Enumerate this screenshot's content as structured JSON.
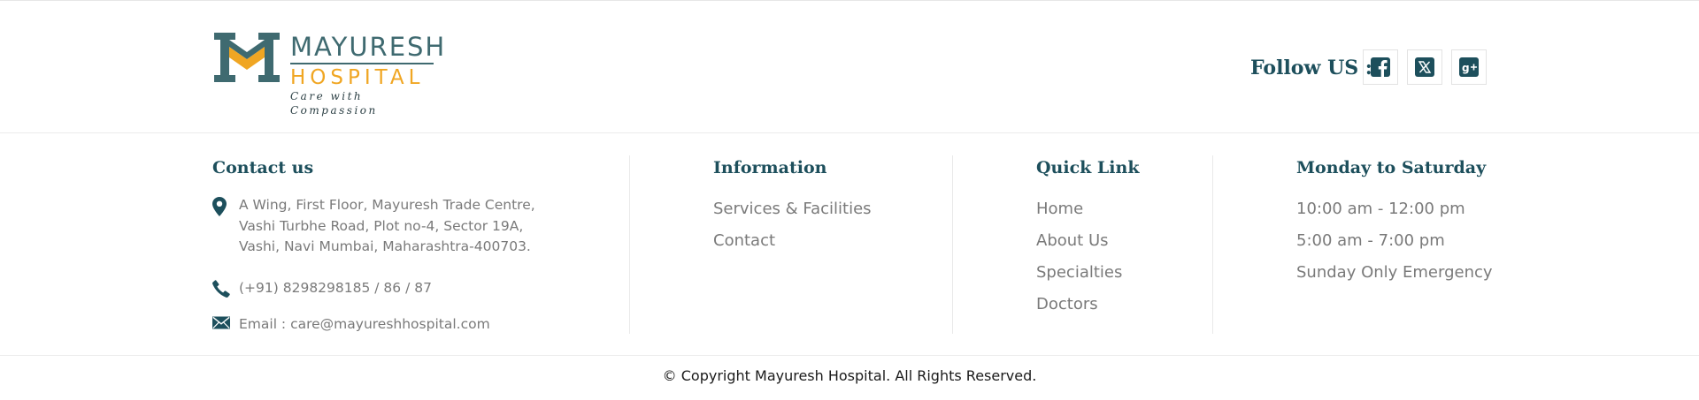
{
  "header": {
    "logo": {
      "name": "MAYURESH",
      "sub": "HOSPITAL",
      "tagline": "Care with Compassion"
    },
    "follow_label": "Follow US :",
    "social": [
      {
        "icon": "facebook-icon"
      },
      {
        "icon": "x-twitter-icon"
      },
      {
        "icon": "google-plus-icon"
      }
    ]
  },
  "contact": {
    "title": "Contact us",
    "address_lines": [
      "A Wing, First Floor, Mayuresh Trade Centre,",
      "Vashi Turbhe Road, Plot no-4, Sector 19A,",
      "Vashi, Navi Mumbai, Maharashtra-400703."
    ],
    "phone": "(+91) 8298298185 / 86 / 87",
    "email": "Email : care@mayureshhospital.com",
    "icons": [
      "map-pin-icon",
      "phone-icon",
      "envelope-icon"
    ]
  },
  "information": {
    "title": "Information",
    "links": [
      "Services & Facilities",
      "Contact"
    ]
  },
  "quick_link": {
    "title": "Quick Link",
    "links": [
      "Home",
      "About Us",
      "Specialties",
      "Doctors"
    ]
  },
  "hours": {
    "title": "Monday to Saturday",
    "items": [
      "10:00 am - 12:00 pm",
      "5:00 am - 7:00 pm",
      "Sunday Only Emergency"
    ]
  },
  "footer": {
    "copyright": "© Copyright Mayuresh Hospital. All Rights Reserved."
  },
  "colors": {
    "brand_teal": "#1d4f5c",
    "logo_teal": "#3f6a70",
    "logo_orange": "#f0a623",
    "text_gray": "#7a7a7a"
  }
}
